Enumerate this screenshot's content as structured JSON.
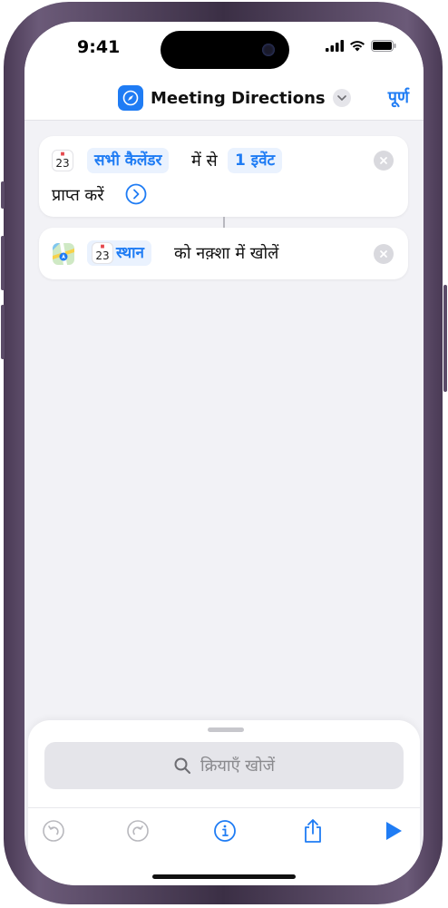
{
  "status_bar": {
    "time": "9:41"
  },
  "nav": {
    "title": "Meeting Directions",
    "done_label": "पूर्ण"
  },
  "actions": [
    {
      "icon": "calendar-icon",
      "calendar_day": "23",
      "token_source": "सभी कैलेंडर",
      "text_from": "में से",
      "token_count": "1 इवेंट",
      "text_get": "प्राप्त करें"
    },
    {
      "icon": "maps-icon",
      "calendar_day": "23",
      "token_location": "स्थान",
      "text_open": "को नक़्शा में खोलें"
    }
  ],
  "search": {
    "placeholder": "क्रियाएँ खोजें"
  },
  "toolbar": {
    "items": [
      "undo-icon",
      "redo-icon",
      "info-icon",
      "share-icon",
      "play-icon"
    ]
  },
  "colors": {
    "accent": "#1f7cf4",
    "background": "#f2f2f6",
    "token_bg": "#eaf2fe"
  }
}
